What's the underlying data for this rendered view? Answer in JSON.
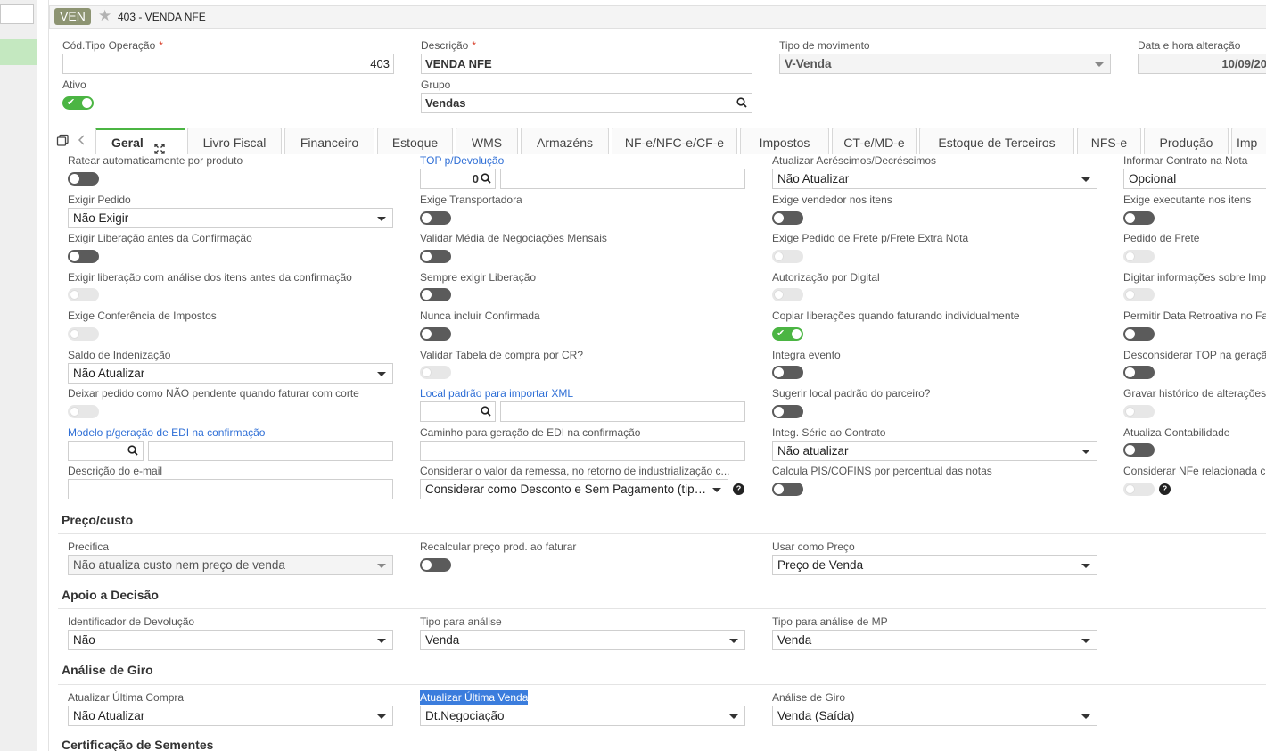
{
  "header": {
    "tag": "VEN",
    "title": "403 - VENDA NFE"
  },
  "top_fields": {
    "cod_label": "Cód.Tipo Operação",
    "cod_value": "403",
    "desc_label": "Descrição",
    "desc_value": "VENDA NFE",
    "tipo_label": "Tipo de movimento",
    "tipo_value": "V-Venda",
    "data_label": "Data e hora alteração",
    "data_value": "10/09/20",
    "ativo_label": "Ativo",
    "grupo_label": "Grupo",
    "grupo_value": "Vendas"
  },
  "tabs": [
    "Geral",
    "Livro Fiscal",
    "Financeiro",
    "Estoque",
    "WMS",
    "Armazéns",
    "NF-e/NFC-e/CF-e",
    "Impostos",
    "CT-e/MD-e",
    "Estoque de Terceiros",
    "NFS-e",
    "Produção",
    "Imp"
  ],
  "geral": {
    "c1": [
      "Ratear automaticamente por produto",
      "Exigir Pedido",
      "Não Exigir",
      "Exigir Liberação antes da Confirmação",
      "Exigir liberação com análise dos itens antes da confirmação",
      "Exige Conferência de Impostos",
      "Saldo de Indenização",
      "Não Atualizar",
      "Deixar pedido como NÃO pendente quando faturar com corte",
      "Modelo p/geração de EDI na confirmação",
      "Descrição do e-mail"
    ],
    "c2": [
      "TOP p/Devolução",
      "0",
      "Exige Transportadora",
      "Validar Média de Negociações Mensais",
      "Sempre exigir Liberação",
      "Nunca incluir Confirmada",
      "Validar Tabela de compra por CR?",
      "Local padrão para importar XML",
      "Caminho para geração de EDI na confirmação",
      "Considerar o valor da remessa, no retorno de industrialização c...",
      "Considerar como Desconto e Sem Pagamento (tipo..."
    ],
    "c3": [
      "Atualizar Acréscimos/Decréscimos",
      "Não Atualizar",
      "Exige vendedor nos itens",
      "Exige Pedido de Frete p/Frete Extra Nota",
      "Autorização por Digital",
      "Copiar liberações quando faturando individualmente",
      "Integra evento",
      "Sugerir local padrão do parceiro?",
      "Integ. Série ao Contrato",
      "Não atualizar",
      "Calcula PIS/COFINS por percentual das notas"
    ],
    "c4": [
      "Informar Contrato na Nota",
      "Opcional",
      "Exige executante nos itens",
      "Pedido de Frete",
      "Digitar informações sobre Imp",
      "Permitir Data Retroativa no Fa",
      "Desconsiderar TOP na geraçã",
      "Gravar histórico de alterações",
      "Atualiza Contabilidade",
      "Considerar NFe relacionada c"
    ]
  },
  "preco": {
    "title": "Preço/custo",
    "precifica_label": "Precifica",
    "precifica_value": "Não atualiza custo nem preço de venda",
    "recalc_label": "Recalcular preço prod. ao faturar",
    "usar_label": "Usar como Preço",
    "usar_value": "Preço de Venda"
  },
  "apoio": {
    "title": "Apoio a Decisão",
    "ident_label": "Identificador de Devolução",
    "ident_value": "Não",
    "tipo_label": "Tipo para análise",
    "tipo_value": "Venda",
    "tipomp_label": "Tipo para análise de MP",
    "tipomp_value": "Venda"
  },
  "giro": {
    "title": "Análise de Giro",
    "compra_label": "Atualizar Última Compra",
    "compra_value": "Não Atualizar",
    "venda_label": "Atualizar Última Venda",
    "venda_value": "Dt.Negociação",
    "analise_label": "Análise de Giro",
    "analise_value": "Venda (Saída)"
  },
  "cert": {
    "title": "Certificação de Sementes"
  }
}
